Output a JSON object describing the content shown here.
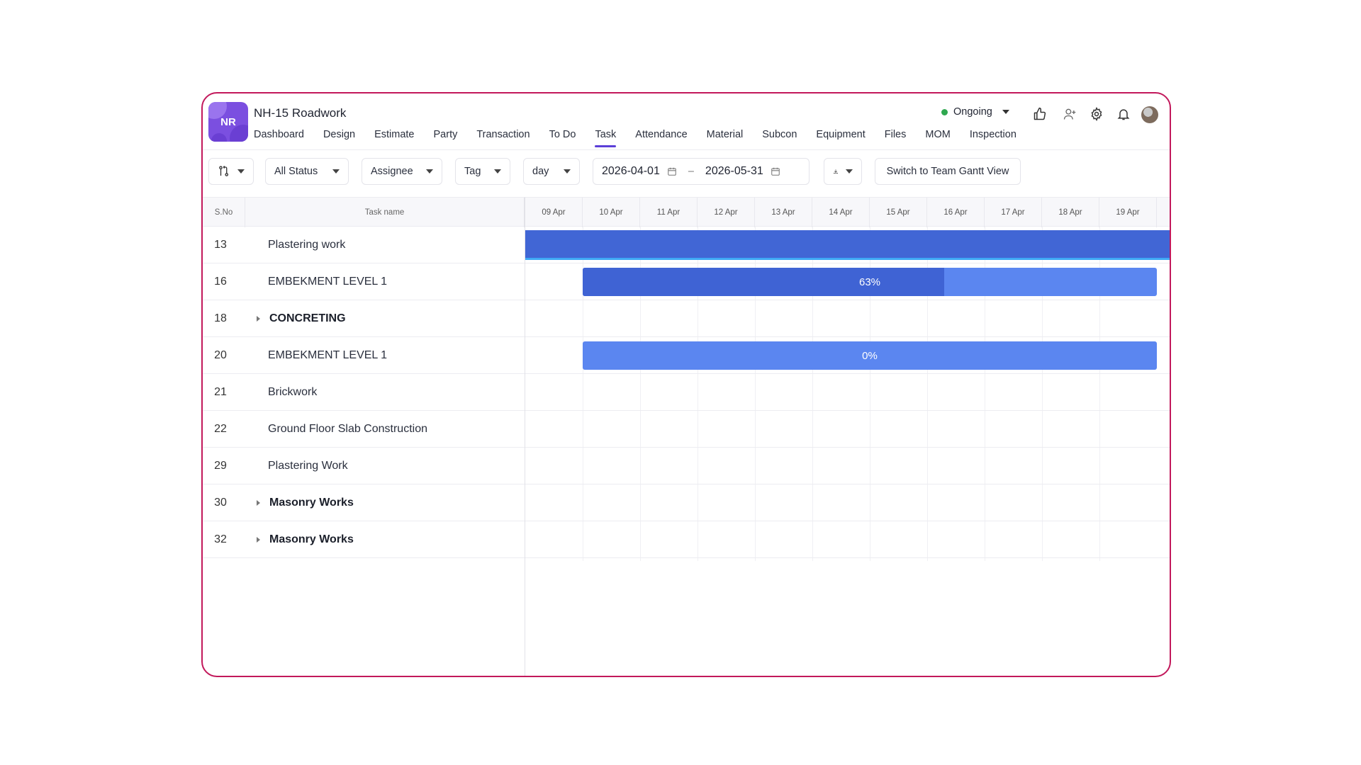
{
  "project": {
    "initials": "NR",
    "title": "NH-15 Roadwork"
  },
  "nav": [
    {
      "label": "Dashboard",
      "active": false
    },
    {
      "label": "Design",
      "active": false
    },
    {
      "label": "Estimate",
      "active": false
    },
    {
      "label": "Party",
      "active": false
    },
    {
      "label": "Transaction",
      "active": false
    },
    {
      "label": "To Do",
      "active": false
    },
    {
      "label": "Task",
      "active": true
    },
    {
      "label": "Attendance",
      "active": false
    },
    {
      "label": "Material",
      "active": false
    },
    {
      "label": "Subcon",
      "active": false
    },
    {
      "label": "Equipment",
      "active": false
    },
    {
      "label": "Files",
      "active": false
    },
    {
      "label": "MOM",
      "active": false
    },
    {
      "label": "Inspection",
      "active": false
    }
  ],
  "header": {
    "status_label": "Ongoing",
    "status_color": "#2fa84f"
  },
  "toolbar": {
    "status_filter": "All Status",
    "assignee_filter": "Assignee",
    "tag_filter": "Tag",
    "scale": "day",
    "start_date": "2026-04-01",
    "range_separator": "–",
    "end_date": "2026-05-31",
    "team_gantt_button": "Switch to Team Gantt View"
  },
  "table": {
    "sno_header": "S.No",
    "task_header": "Task name",
    "days": [
      "09 Apr",
      "10 Apr",
      "11 Apr",
      "12 Apr",
      "13 Apr",
      "14 Apr",
      "15 Apr",
      "16 Apr",
      "17 Apr",
      "18 Apr",
      "19 Apr"
    ],
    "rows": [
      {
        "sno": "13",
        "name": "Plastering work",
        "group": false
      },
      {
        "sno": "16",
        "name": "EMBEKMENT LEVEL 1",
        "group": false
      },
      {
        "sno": "18",
        "name": "CONCRETING",
        "group": true
      },
      {
        "sno": "20",
        "name": "EMBEKMENT LEVEL 1",
        "group": false
      },
      {
        "sno": "21",
        "name": "Brickwork",
        "group": false
      },
      {
        "sno": "22",
        "name": "Ground Floor Slab Construction",
        "group": false
      },
      {
        "sno": "29",
        "name": "Plastering Work",
        "group": false
      },
      {
        "sno": "30",
        "name": "Masonry Works",
        "group": true
      },
      {
        "sno": "32",
        "name": "Masonry Works",
        "group": true
      }
    ],
    "bars": [
      {
        "row": 0,
        "progress_label": "",
        "progress": 1.0,
        "color": "#4166d5",
        "fill_color": "#4166d5"
      },
      {
        "row": 1,
        "progress_label": "63%",
        "progress": 0.63,
        "color": "#5b86f0",
        "fill_color": "#3f63d4"
      },
      {
        "row": 3,
        "progress_label": "0%",
        "progress": 0.0,
        "color": "#5b86f0",
        "fill_color": "#3f63d4"
      }
    ]
  }
}
